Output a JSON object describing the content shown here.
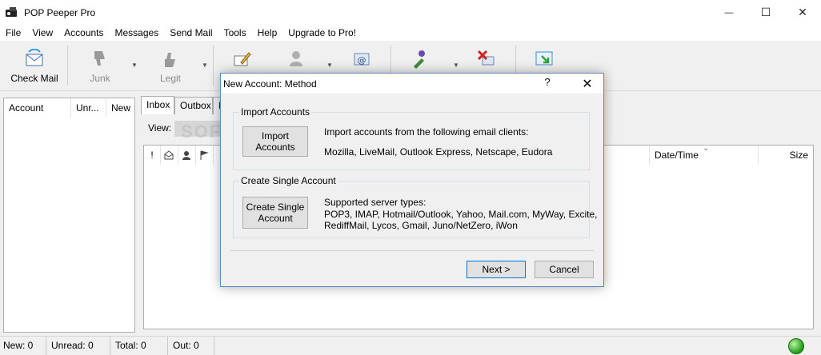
{
  "window": {
    "title": "POP Peeper Pro",
    "minimize_glyph": "—",
    "maximize_glyph": "☐",
    "close_glyph": "✕"
  },
  "menu": [
    "File",
    "View",
    "Accounts",
    "Messages",
    "Send Mail",
    "Tools",
    "Help",
    "Upgrade to Pro!"
  ],
  "toolbar": {
    "check_mail": "Check Mail",
    "junk": "Junk",
    "legit": "Legit"
  },
  "accounts_panel": {
    "headers": [
      "Account",
      "Unr...",
      "New"
    ]
  },
  "tabs": [
    "Inbox",
    "Outbox",
    "I"
  ],
  "view_label": "View:",
  "message_list": {
    "headers": [
      "!",
      "Date/Time",
      "Size"
    ]
  },
  "status": {
    "new": "New: 0",
    "unread": "Unread: 0",
    "total": "Total: 0",
    "out": "Out: 0"
  },
  "watermark": "SOFTPEDIA",
  "dialog": {
    "title": "New Account: Method",
    "help_glyph": "?",
    "close_glyph": "✕",
    "import_group": {
      "title": "Import Accounts",
      "button_line1": "Import",
      "button_line2": "Accounts",
      "text_line1": "Import accounts from the following email clients:",
      "text_line2": "Mozilla, LiveMail, Outlook Express, Netscape, Eudora"
    },
    "create_group": {
      "title": "Create Single Account",
      "button_line1": "Create Single",
      "button_line2": "Account",
      "text_line1": "Supported server types:",
      "text_line2": "POP3, IMAP, Hotmail/Outlook, Yahoo, Mail.com, MyWay, Excite,",
      "text_line3": "RediffMail, Lycos, Gmail, Juno/NetZero, iWon"
    },
    "next_button": "Next >",
    "cancel_button": "Cancel"
  },
  "colors": {
    "dialog_border": "#5d87c4",
    "default_button_border": "#0078d7",
    "status_ok": "#1f9a17"
  }
}
